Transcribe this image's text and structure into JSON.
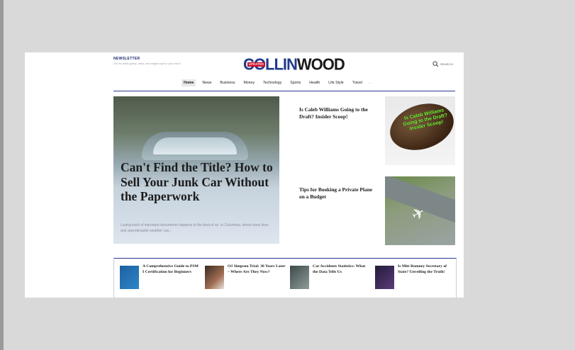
{
  "newsletter": {
    "title": "NEWSLETTER",
    "subtitle": "Get the latest gossip, news, and insights right to your inbox!"
  },
  "logo": {
    "collin": "COLLIN",
    "wood": "WOOD",
    "tag": "UPDATED"
  },
  "search": {
    "label": "SEARCH"
  },
  "nav": {
    "items": [
      "Home",
      "News",
      "Business",
      "Money",
      "Technology",
      "Sports",
      "Health",
      "Life Style",
      "Travel"
    ],
    "more": "..."
  },
  "hero": {
    "title": "Can't Find the Title? How to Sell Your Junk Car Without the Paperwork",
    "excerpt": "Losing track of important documents happens to the best of us. In Columbus, where busy lives and unpredictable weather can..."
  },
  "cards": [
    {
      "title": "Is Caleb Williams Going to the Draft? Insider Scoop!",
      "image_text": "Is Caleb Williams Going to the Draft? Insider Scoop!"
    },
    {
      "title": "Tips for Booking a Private Plane on a Budget"
    }
  ],
  "bottom": [
    {
      "title": "A Comprehensive Guide to PSM I Certification for Beginners"
    },
    {
      "title": "OJ Simpson Trial: 30 Years Later – Where Are They Now?"
    },
    {
      "title": "Car Accidents Statistics: What the Data Tells Us"
    },
    {
      "title": "Is Mitt Romney Secretary of State? Unveiling the Truth!"
    }
  ],
  "colors": {
    "brand_blue": "#223a8c",
    "accent_red": "#c8102e"
  }
}
